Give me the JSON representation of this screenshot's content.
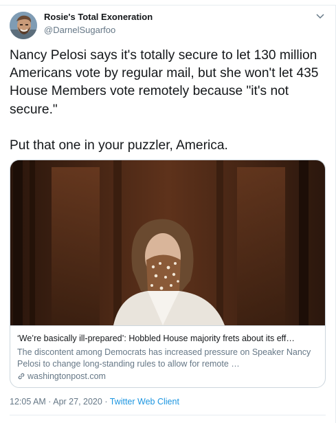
{
  "author": {
    "name": "Rosie's Total Exoneration",
    "handle": "@DarnelSugarfoo",
    "avatar_icon": "avatar-photo"
  },
  "tweet": {
    "text": "Nancy Pelosi says it's totally secure to let 130 million Americans vote by regular mail, but she won't let 435 House Members vote remotely because \"it's not secure.\"\n\nPut that one in your puzzler, America."
  },
  "card": {
    "title": "‘We’re basically ill-prepared’: Hobbled House majority frets about its eff…",
    "description": "The discontent among Democrats has increased pressure on Speaker Nancy Pelosi to change long-standing rules to allow for remote …",
    "domain": "washingtonpost.com",
    "link_icon": "link-icon"
  },
  "meta": {
    "time": "12:05 AM",
    "separator1": " · ",
    "date": "Apr 27, 2020",
    "separator2": " · ",
    "client": "Twitter Web Client"
  },
  "colors": {
    "text": "#14171a",
    "secondary": "#657786",
    "link": "#1b95e0",
    "border": "#ccd6dd"
  }
}
